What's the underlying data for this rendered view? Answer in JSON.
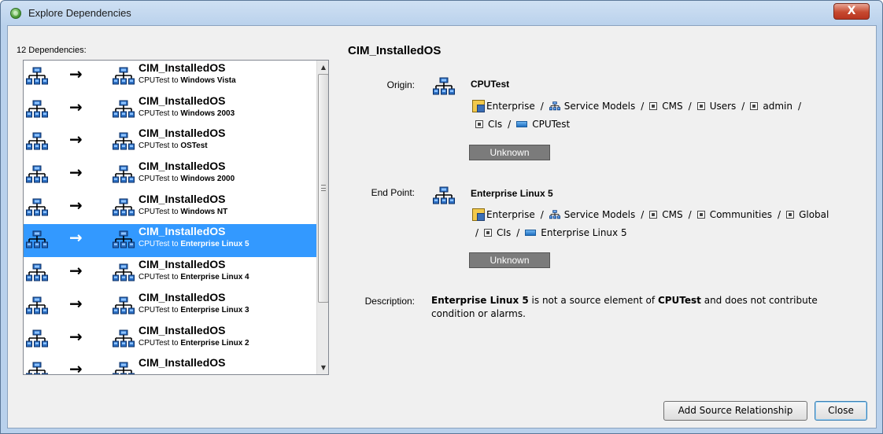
{
  "window": {
    "title": "Explore Dependencies",
    "close_glyph": "X"
  },
  "list": {
    "count_label": "12 Dependencies:",
    "rows": [
      {
        "name": "CIM_InstalledOS",
        "from": "CPUTest to",
        "to": "Windows Vista",
        "selected": false
      },
      {
        "name": "CIM_InstalledOS",
        "from": "CPUTest to",
        "to": "Windows 2003",
        "selected": false
      },
      {
        "name": "CIM_InstalledOS",
        "from": "CPUTest to",
        "to": "OSTest",
        "selected": false
      },
      {
        "name": "CIM_InstalledOS",
        "from": "CPUTest to",
        "to": "Windows 2000",
        "selected": false
      },
      {
        "name": "CIM_InstalledOS",
        "from": "CPUTest to",
        "to": "Windows NT",
        "selected": false
      },
      {
        "name": "CIM_InstalledOS",
        "from": "CPUTest to",
        "to": "Enterprise Linux 5",
        "selected": true
      },
      {
        "name": "CIM_InstalledOS",
        "from": "CPUTest to",
        "to": "Enterprise Linux 4",
        "selected": false
      },
      {
        "name": "CIM_InstalledOS",
        "from": "CPUTest to",
        "to": "Enterprise Linux 3",
        "selected": false
      },
      {
        "name": "CIM_InstalledOS",
        "from": "CPUTest to",
        "to": "Enterprise Linux 2",
        "selected": false
      },
      {
        "name": "CIM_InstalledOS",
        "from": "",
        "to": "",
        "selected": false
      }
    ],
    "arrow_glyph": "→",
    "icon": "network-hierarchy-icon"
  },
  "detail": {
    "title": "CIM_InstalledOS",
    "origin": {
      "label": "Origin:",
      "name": "CPUTest",
      "path_line1": [
        "Enterprise",
        "Service Models",
        "CMS",
        "Users",
        "admin"
      ],
      "path_line2": [
        "CIs",
        "CPUTest"
      ],
      "status": "Unknown"
    },
    "endpoint": {
      "label": "End Point:",
      "name": "Enterprise Linux 5",
      "path_line1": [
        "Enterprise",
        "Service Models",
        "CMS",
        "Communities",
        "Global"
      ],
      "path_line2": [
        "CIs",
        "Enterprise Linux 5"
      ],
      "status": "Unknown"
    },
    "separator": "/",
    "description": {
      "label": "Description:",
      "target": "Enterprise Linux 5",
      "mid": " is not a source element of ",
      "source": "CPUTest",
      "tail": " and does not contribute condition or alarms."
    }
  },
  "buttons": {
    "add_source": "Add Source Relationship",
    "close": "Close"
  }
}
